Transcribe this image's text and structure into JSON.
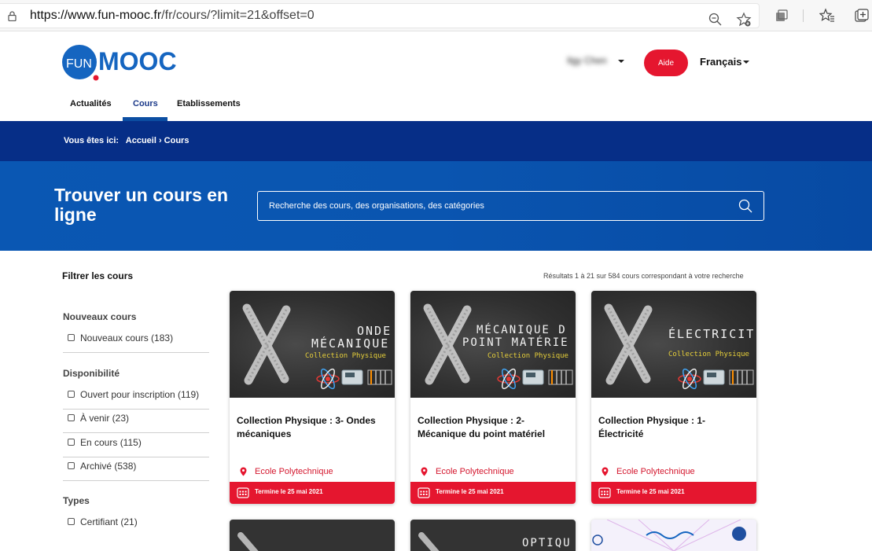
{
  "browser": {
    "url_host": "https://www.fun-mooc.fr",
    "url_path": "/fr/cours/?limit=21&offset=0"
  },
  "header": {
    "logo_text_left": "FUN",
    "logo_text_right": "MOOC",
    "user_name": "Ilgy Chen",
    "help_label": "Aide",
    "language_label": "Français",
    "nav": [
      "Actualités",
      "Cours",
      "Etablissements"
    ]
  },
  "breadcrumb": {
    "prefix": "Vous êtes ici:",
    "path": "Accueil › Cours"
  },
  "hero": {
    "title": "Trouver un cours en ligne",
    "search_placeholder": "Recherche des cours, des organisations, des catégories"
  },
  "filters": {
    "title": "Filtrer les cours",
    "groups": [
      {
        "title": "Nouveaux cours",
        "options": [
          "Nouveaux cours (183)"
        ]
      },
      {
        "title": "Disponibilité",
        "options": [
          "Ouvert pour inscription (119)",
          "À venir (23)",
          "En cours (115)",
          "Archivé (538)"
        ]
      },
      {
        "title": "Types",
        "options": [
          "Certifiant (21)"
        ]
      }
    ]
  },
  "results_text": "Résultats 1 à 21 sur 584 cours correspondant à votre recherche",
  "cards": [
    {
      "thumb_line1": "ONDE",
      "thumb_line2": "MÉCANIQUE",
      "thumb_sub": "Collection Physique",
      "title": "Collection Physique : 3- Ondes mécaniques",
      "org": "Ecole Polytechnique",
      "date": "Termine le 25 mai 2021"
    },
    {
      "thumb_line1": "MÉCANIQUE D",
      "thumb_line2": "POINT MATÉRIE",
      "thumb_sub": "Collection Physique",
      "title": "Collection Physique : 2- Mécanique du point matériel",
      "org": "Ecole Polytechnique",
      "date": "Termine le 25 mai 2021"
    },
    {
      "thumb_line1": "ÉLECTRICIT",
      "thumb_line2": "",
      "thumb_sub": "Collection Physique",
      "title": "Collection Physique : 1- Électricité",
      "org": "Ecole Polytechnique",
      "date": "Termine le 25 mai 2021"
    }
  ],
  "next_row": [
    {
      "thumb_line1": ""
    },
    {
      "thumb_line1": "OPTIQU"
    },
    {
      "thumb_line1": ""
    }
  ],
  "colors": {
    "brand_blue": "#062e87",
    "hero_blue": "#0a57b3",
    "accent_red": "#e5162f"
  }
}
